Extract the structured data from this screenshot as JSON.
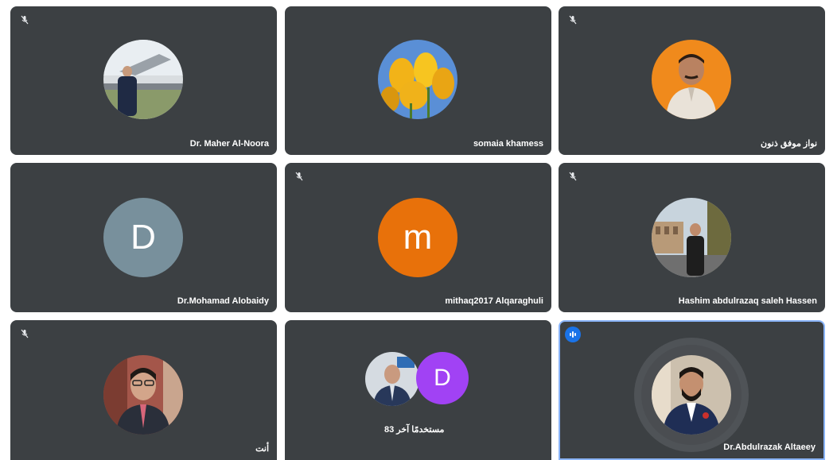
{
  "participants": [
    {
      "name": "Dr. Maher Al-Noora",
      "muted": true
    },
    {
      "name": "somaia khamess",
      "muted": false
    },
    {
      "name": "ﻧﻮﺍﺯ ﻣﻮﻓﻖ ﺫﻧﻮﻥ",
      "muted": true
    },
    {
      "name": "Dr.Mohamad Alobaidy",
      "muted": false,
      "initial": "D"
    },
    {
      "name": "mithaq2017 Alqaraghuli",
      "muted": true,
      "initial": "m"
    },
    {
      "name": "Hashim abdulrazaq saleh Hassen",
      "muted": true
    },
    {
      "name": "ﺃﻧﺖ",
      "muted": true
    },
    {
      "name": "83 ﻣﺴﺘﺨﺪﻣًﺎ ﺁﺧﺮ",
      "muted": false,
      "initial": "D"
    },
    {
      "name": "Dr.Abdulrazak Altaeey",
      "muted": false,
      "speaking": true
    }
  ],
  "colors": {
    "tile": "#3c4043",
    "active_border": "#8ab4f8",
    "speaking_badge": "#1a73e8",
    "avatar_grey": "#78909c",
    "avatar_orange": "#e8710a",
    "avatar_purple": "#a142f4"
  }
}
